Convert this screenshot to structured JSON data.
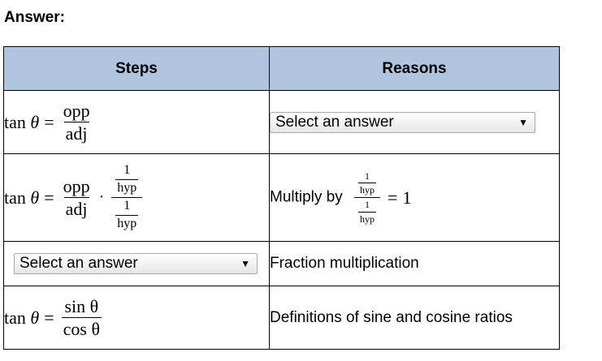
{
  "heading": "Answer:",
  "table": {
    "headers": {
      "steps": "Steps",
      "reasons": "Reasons"
    },
    "rows": [
      {
        "step": {
          "lhs": "tan",
          "theta": "θ",
          "eq": "=",
          "num": "opp",
          "den": "adj"
        },
        "reason": {
          "select_value": "Select an answer"
        }
      },
      {
        "step": {
          "lhs": "tan",
          "theta": "θ",
          "eq": "=",
          "num": "opp",
          "den": "adj",
          "dot": "·",
          "inner_num_num": "1",
          "inner_num_den": "hyp",
          "inner_den_num": "1",
          "inner_den_den": "hyp"
        },
        "reason": {
          "text": "Multiply by",
          "one": "1",
          "hyp": "hyp",
          "eq": "=",
          "rhs": "1"
        }
      },
      {
        "step": {
          "select_value": "Select an answer"
        },
        "reason": {
          "text": "Fraction multiplication"
        }
      },
      {
        "step": {
          "lhs": "tan",
          "theta": "θ",
          "eq": "=",
          "num": "sin θ",
          "den": "cos θ"
        },
        "reason": {
          "text": "Definitions of sine and cosine ratios"
        }
      }
    ]
  },
  "icons": {
    "dropdown": "chevron-down-icon"
  }
}
